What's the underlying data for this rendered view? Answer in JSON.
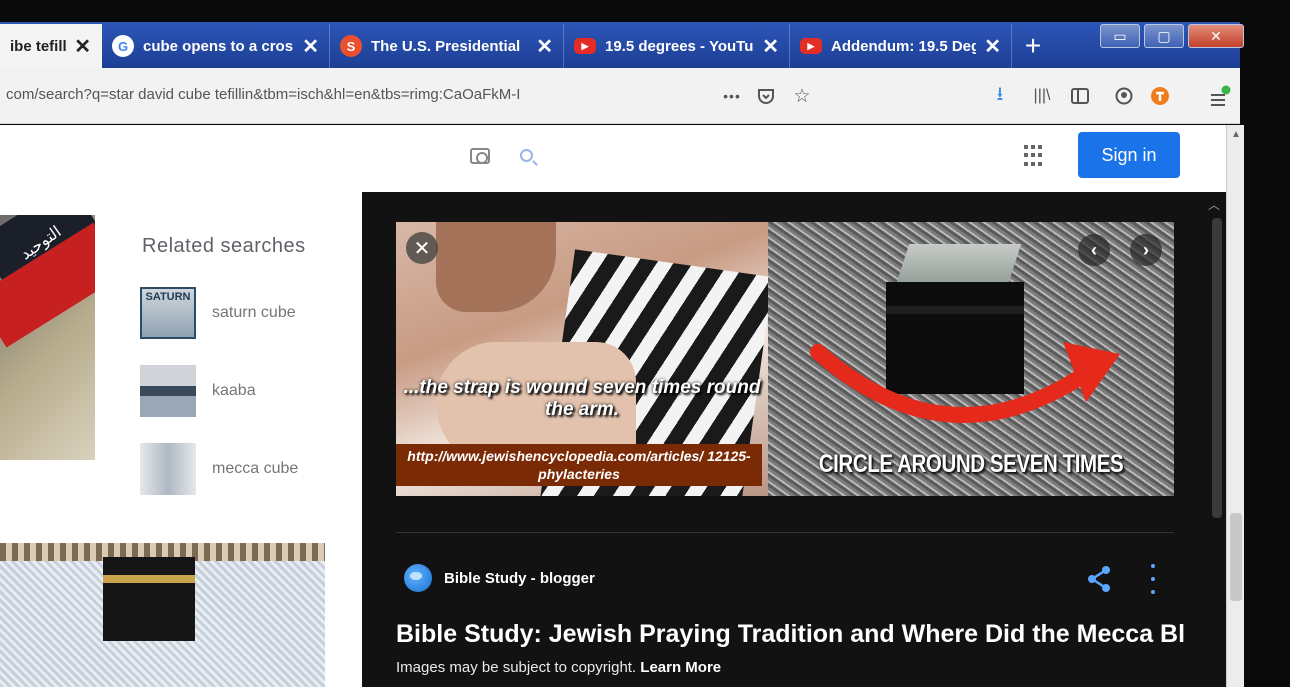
{
  "browser": {
    "tabs": [
      {
        "title": "ibe tefill",
        "close": "✕",
        "active": true
      },
      {
        "title": "cube opens to a cros",
        "close": "✕",
        "favicon": "google-icon"
      },
      {
        "title": "The U.S. Presidential",
        "close": "✕",
        "favicon": "site-icon"
      },
      {
        "title": "19.5 degrees - YouTu",
        "close": "✕",
        "favicon": "youtube-icon"
      },
      {
        "title": "Addendum: 19.5 Deg",
        "close": "✕",
        "favicon": "youtube-icon"
      }
    ],
    "new_tab": "+",
    "url": "com/search?q=star david cube tefillin&tbm=isch&hl=en&tbs=rimg:CaOaFkM-I",
    "more_menu": "•••",
    "window": {
      "minimize": "▭",
      "maximize": "▢",
      "close": "✕"
    }
  },
  "page": {
    "sign_in": "Sign in",
    "related": {
      "title": "Related searches",
      "items": [
        {
          "label": "saturn cube",
          "thumb_text": "SATURN"
        },
        {
          "label": "kaaba"
        },
        {
          "label": "mecca cube"
        }
      ]
    },
    "thumb_left_text": "التوحيد"
  },
  "viewer": {
    "close": "✕",
    "prev": "‹",
    "next": "›",
    "caption_left": "...the strap is wound seven times round the arm.",
    "caption_url": "http://www.jewishencyclopedia.com/articles/ 12125-phylacteries",
    "caption_right": "CIRCLE AROUND SEVEN TIMES",
    "source": "Bible Study - blogger",
    "title": "Bible Study: Jewish Praying Tradition and Where Did the Mecca Bl",
    "copyright": "Images may be subject to copyright.",
    "learn_more": "Learn More"
  },
  "colors": {
    "tab_strip": "#2d56b8",
    "sign_in": "#1a73e8",
    "viewer_bg": "#121212",
    "arrow": "#e52a1c"
  }
}
